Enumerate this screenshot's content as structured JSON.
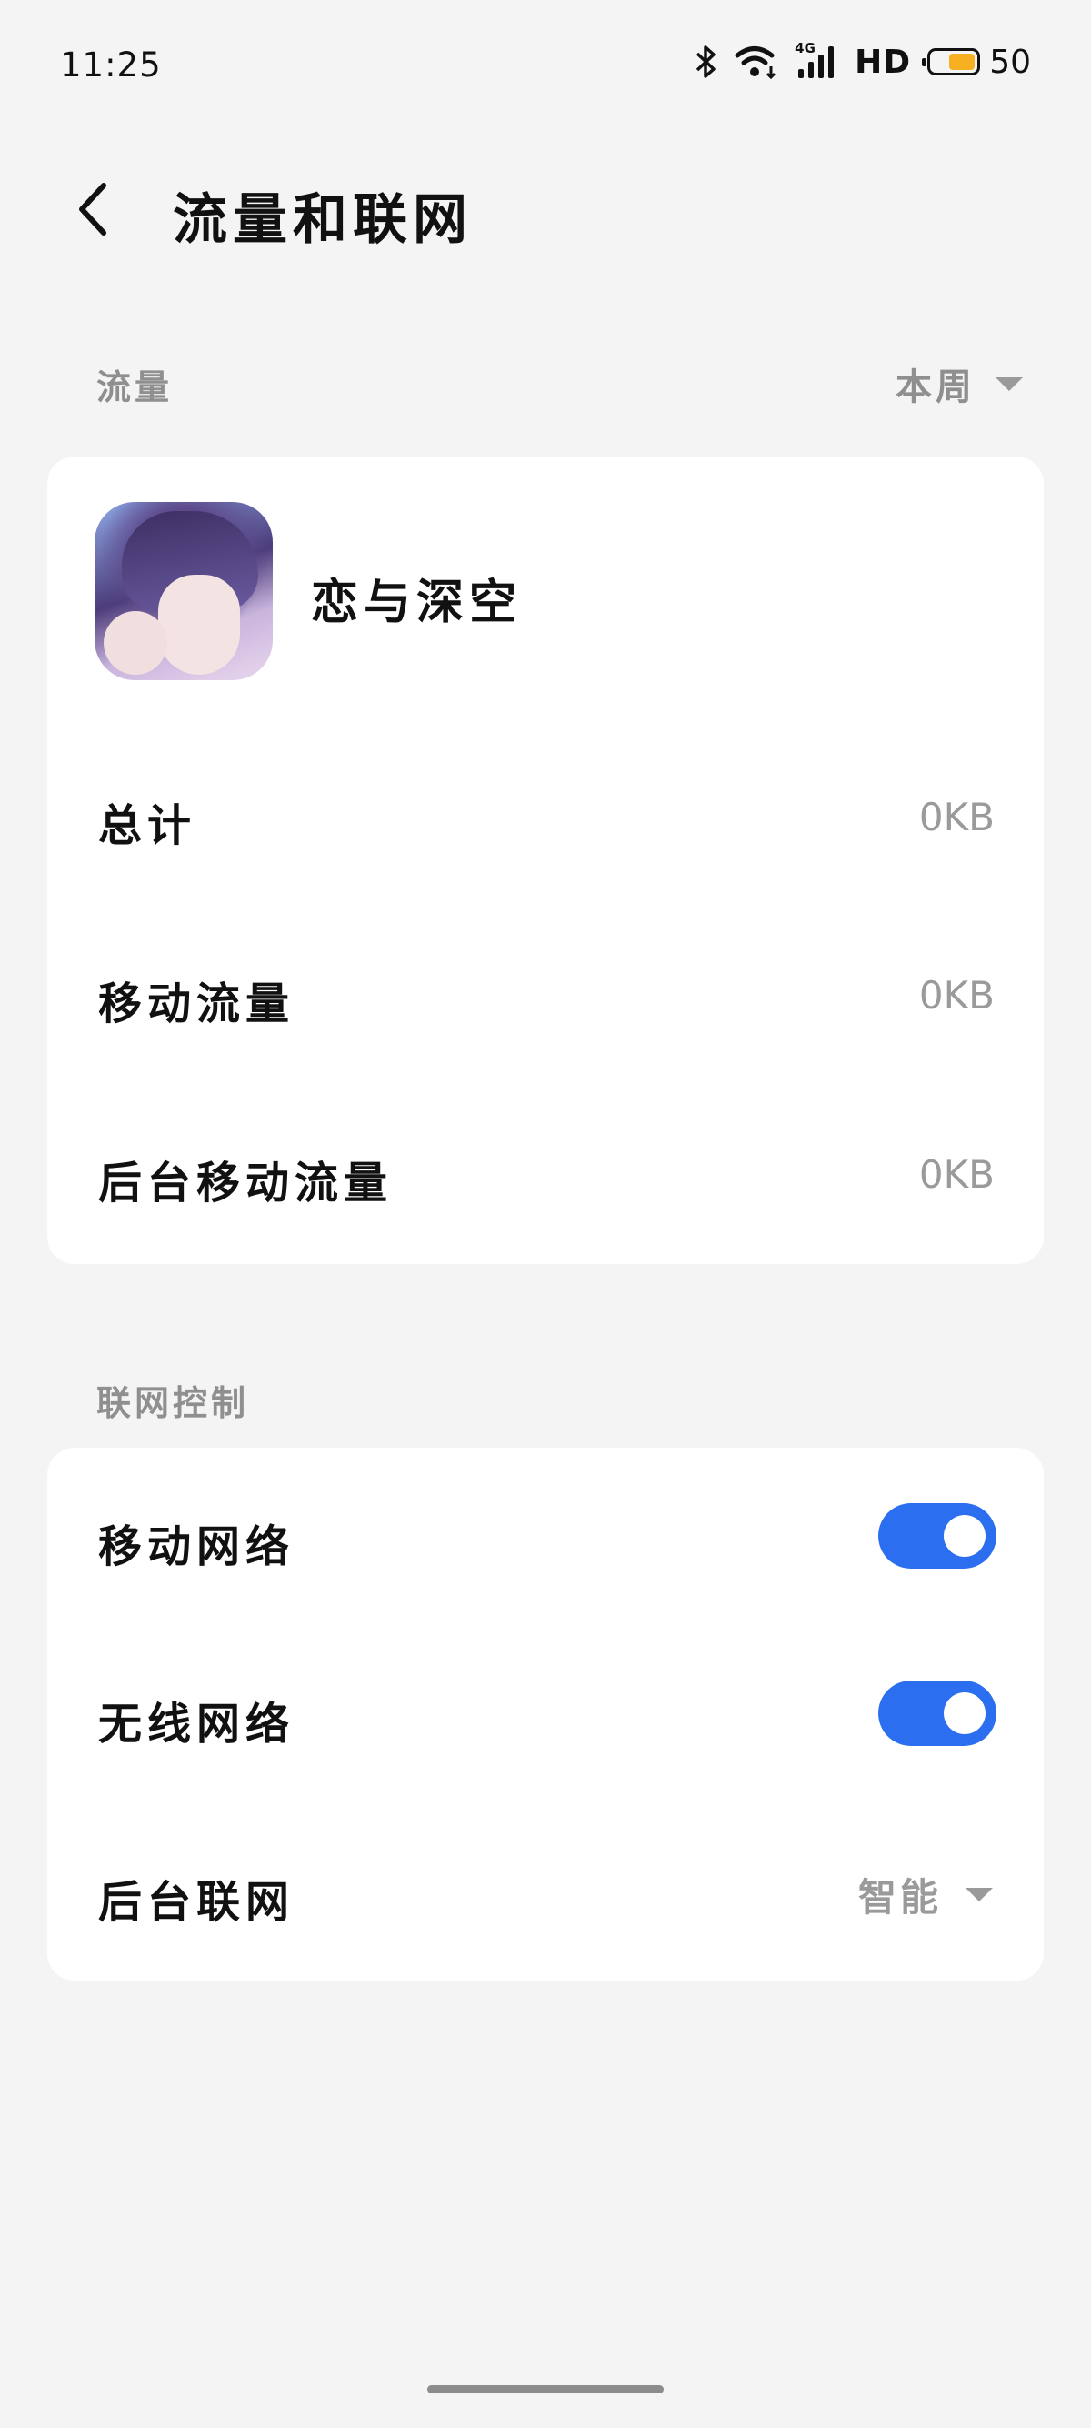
{
  "status_bar": {
    "time": "11:25",
    "network_type": "4G",
    "hd_label": "HD",
    "battery": "50",
    "icons": [
      "bluetooth-icon",
      "wifi-icon",
      "signal-icon",
      "battery-icon"
    ]
  },
  "header": {
    "title": "流量和联网",
    "back_icon": "chevron-left-icon"
  },
  "traffic_section": {
    "label": "流量",
    "period": "本周",
    "app_name": "恋与深空",
    "rows": [
      {
        "label": "总计",
        "value": "0KB"
      },
      {
        "label": "移动流量",
        "value": "0KB"
      },
      {
        "label": "后台移动流量",
        "value": "0KB"
      }
    ]
  },
  "network_section": {
    "label": "联网控制",
    "rows": [
      {
        "label": "移动网络",
        "toggle_on": true
      },
      {
        "label": "无线网络",
        "toggle_on": true
      },
      {
        "label": "后台联网",
        "value": "智能"
      }
    ]
  },
  "colors": {
    "background": "#f4f4f4",
    "card": "#ffffff",
    "accent": "#2b6ef0",
    "secondary_text": "#9a9a9a"
  }
}
